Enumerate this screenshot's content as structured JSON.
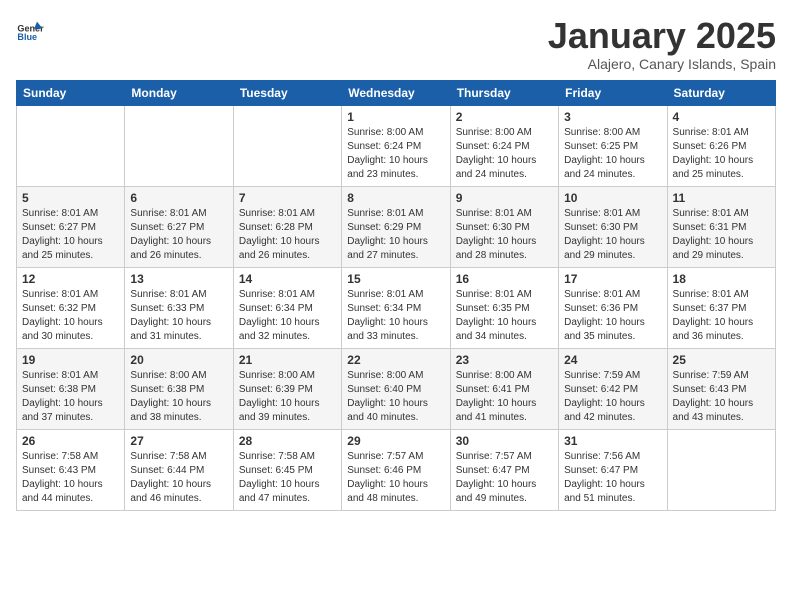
{
  "logo": {
    "general": "General",
    "blue": "Blue"
  },
  "header": {
    "title": "January 2025",
    "subtitle": "Alajero, Canary Islands, Spain"
  },
  "days_of_week": [
    "Sunday",
    "Monday",
    "Tuesday",
    "Wednesday",
    "Thursday",
    "Friday",
    "Saturday"
  ],
  "weeks": [
    [
      {
        "day": "",
        "info": ""
      },
      {
        "day": "",
        "info": ""
      },
      {
        "day": "",
        "info": ""
      },
      {
        "day": "1",
        "info": "Sunrise: 8:00 AM\nSunset: 6:24 PM\nDaylight: 10 hours\nand 23 minutes."
      },
      {
        "day": "2",
        "info": "Sunrise: 8:00 AM\nSunset: 6:24 PM\nDaylight: 10 hours\nand 24 minutes."
      },
      {
        "day": "3",
        "info": "Sunrise: 8:00 AM\nSunset: 6:25 PM\nDaylight: 10 hours\nand 24 minutes."
      },
      {
        "day": "4",
        "info": "Sunrise: 8:01 AM\nSunset: 6:26 PM\nDaylight: 10 hours\nand 25 minutes."
      }
    ],
    [
      {
        "day": "5",
        "info": "Sunrise: 8:01 AM\nSunset: 6:27 PM\nDaylight: 10 hours\nand 25 minutes."
      },
      {
        "day": "6",
        "info": "Sunrise: 8:01 AM\nSunset: 6:27 PM\nDaylight: 10 hours\nand 26 minutes."
      },
      {
        "day": "7",
        "info": "Sunrise: 8:01 AM\nSunset: 6:28 PM\nDaylight: 10 hours\nand 26 minutes."
      },
      {
        "day": "8",
        "info": "Sunrise: 8:01 AM\nSunset: 6:29 PM\nDaylight: 10 hours\nand 27 minutes."
      },
      {
        "day": "9",
        "info": "Sunrise: 8:01 AM\nSunset: 6:30 PM\nDaylight: 10 hours\nand 28 minutes."
      },
      {
        "day": "10",
        "info": "Sunrise: 8:01 AM\nSunset: 6:30 PM\nDaylight: 10 hours\nand 29 minutes."
      },
      {
        "day": "11",
        "info": "Sunrise: 8:01 AM\nSunset: 6:31 PM\nDaylight: 10 hours\nand 29 minutes."
      }
    ],
    [
      {
        "day": "12",
        "info": "Sunrise: 8:01 AM\nSunset: 6:32 PM\nDaylight: 10 hours\nand 30 minutes."
      },
      {
        "day": "13",
        "info": "Sunrise: 8:01 AM\nSunset: 6:33 PM\nDaylight: 10 hours\nand 31 minutes."
      },
      {
        "day": "14",
        "info": "Sunrise: 8:01 AM\nSunset: 6:34 PM\nDaylight: 10 hours\nand 32 minutes."
      },
      {
        "day": "15",
        "info": "Sunrise: 8:01 AM\nSunset: 6:34 PM\nDaylight: 10 hours\nand 33 minutes."
      },
      {
        "day": "16",
        "info": "Sunrise: 8:01 AM\nSunset: 6:35 PM\nDaylight: 10 hours\nand 34 minutes."
      },
      {
        "day": "17",
        "info": "Sunrise: 8:01 AM\nSunset: 6:36 PM\nDaylight: 10 hours\nand 35 minutes."
      },
      {
        "day": "18",
        "info": "Sunrise: 8:01 AM\nSunset: 6:37 PM\nDaylight: 10 hours\nand 36 minutes."
      }
    ],
    [
      {
        "day": "19",
        "info": "Sunrise: 8:01 AM\nSunset: 6:38 PM\nDaylight: 10 hours\nand 37 minutes."
      },
      {
        "day": "20",
        "info": "Sunrise: 8:00 AM\nSunset: 6:38 PM\nDaylight: 10 hours\nand 38 minutes."
      },
      {
        "day": "21",
        "info": "Sunrise: 8:00 AM\nSunset: 6:39 PM\nDaylight: 10 hours\nand 39 minutes."
      },
      {
        "day": "22",
        "info": "Sunrise: 8:00 AM\nSunset: 6:40 PM\nDaylight: 10 hours\nand 40 minutes."
      },
      {
        "day": "23",
        "info": "Sunrise: 8:00 AM\nSunset: 6:41 PM\nDaylight: 10 hours\nand 41 minutes."
      },
      {
        "day": "24",
        "info": "Sunrise: 7:59 AM\nSunset: 6:42 PM\nDaylight: 10 hours\nand 42 minutes."
      },
      {
        "day": "25",
        "info": "Sunrise: 7:59 AM\nSunset: 6:43 PM\nDaylight: 10 hours\nand 43 minutes."
      }
    ],
    [
      {
        "day": "26",
        "info": "Sunrise: 7:58 AM\nSunset: 6:43 PM\nDaylight: 10 hours\nand 44 minutes."
      },
      {
        "day": "27",
        "info": "Sunrise: 7:58 AM\nSunset: 6:44 PM\nDaylight: 10 hours\nand 46 minutes."
      },
      {
        "day": "28",
        "info": "Sunrise: 7:58 AM\nSunset: 6:45 PM\nDaylight: 10 hours\nand 47 minutes."
      },
      {
        "day": "29",
        "info": "Sunrise: 7:57 AM\nSunset: 6:46 PM\nDaylight: 10 hours\nand 48 minutes."
      },
      {
        "day": "30",
        "info": "Sunrise: 7:57 AM\nSunset: 6:47 PM\nDaylight: 10 hours\nand 49 minutes."
      },
      {
        "day": "31",
        "info": "Sunrise: 7:56 AM\nSunset: 6:47 PM\nDaylight: 10 hours\nand 51 minutes."
      },
      {
        "day": "",
        "info": ""
      }
    ]
  ]
}
